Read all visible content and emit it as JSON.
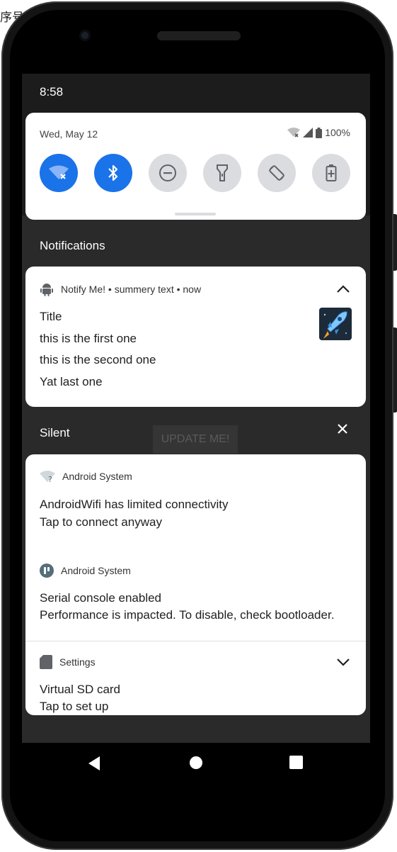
{
  "corner_text": "序号",
  "status": {
    "time": "8:58"
  },
  "quick_settings": {
    "date": "Wed, May 12",
    "battery": "100%",
    "tiles": [
      {
        "name": "wifi-off-icon",
        "active": true
      },
      {
        "name": "bluetooth-icon",
        "active": true
      },
      {
        "name": "do-not-disturb-icon",
        "active": false
      },
      {
        "name": "flashlight-icon",
        "active": false
      },
      {
        "name": "auto-rotate-icon",
        "active": false
      },
      {
        "name": "battery-saver-icon",
        "active": false
      }
    ]
  },
  "sections": {
    "notifications": "Notifications",
    "silent": "Silent"
  },
  "background_button": "UPDATE ME!",
  "notify_card": {
    "header": "Notify Me! • summery text • now",
    "title": "Title",
    "lines": [
      "this is the first one",
      "this is the second one",
      "Yat last one"
    ]
  },
  "silent_cards": [
    {
      "app": "Android System",
      "title": "AndroidWifi has limited connectivity",
      "text": "Tap to connect anyway",
      "icon": "wifi-question-icon"
    },
    {
      "app": "Android System",
      "title": "Serial console enabled",
      "text": "Performance is impacted. To disable, check bootloader.",
      "icon": "android-system-icon"
    },
    {
      "app": "Settings",
      "title": "Virtual SD card",
      "text": "Tap to set up",
      "icon": "sd-card-icon"
    }
  ],
  "colors": {
    "accent": "#1a73e8",
    "panel_bg": "#2a2a2a",
    "card_bg": "#ffffff"
  }
}
